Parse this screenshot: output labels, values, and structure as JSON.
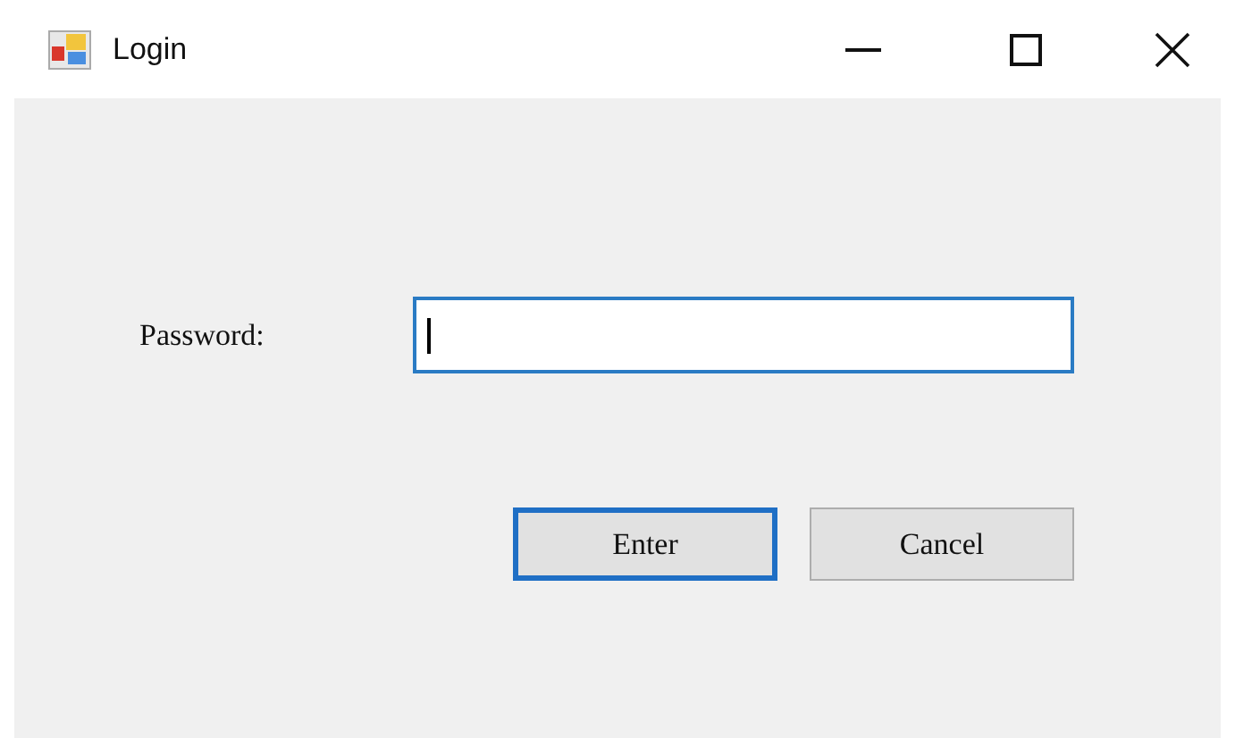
{
  "window": {
    "title": "Login"
  },
  "password": {
    "label": "Password:",
    "focused": true
  },
  "buttons": [
    {
      "label": "Enter",
      "default": true
    },
    {
      "label": "Cancel",
      "default": false
    }
  ]
}
